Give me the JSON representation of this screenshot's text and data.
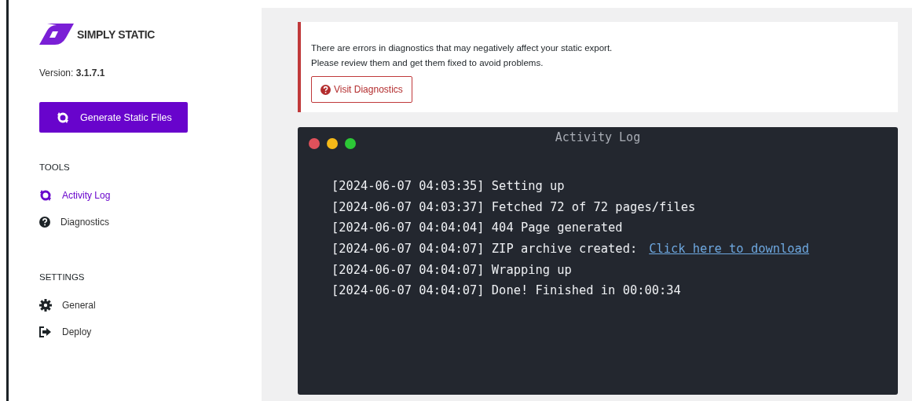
{
  "brand": {
    "name": "SIMPLY STATIC"
  },
  "version": "Version: **3.1.7.1**",
  "generate_button": {
    "label": "Generate Static Files"
  },
  "sections": [
    {
      "title": "TOOLS",
      "items": [
        {
          "label": "Activity Log",
          "kind": "sync",
          "selected": true
        },
        {
          "label": "Diagnostics",
          "kind": "question",
          "selected": false
        }
      ]
    },
    {
      "title": "SETTINGS",
      "items": [
        {
          "label": "General",
          "kind": "gear",
          "selected": false
        },
        {
          "label": "Deploy",
          "kind": "exit",
          "selected": false
        }
      ]
    }
  ],
  "notice": {
    "lines": [
      "There are errors in diagnostics that may negatively affect your static export.",
      "Please review them and get them fixed to avoid problems."
    ],
    "button": "Visit Diagnostics"
  },
  "log": {
    "title": "Activity Log",
    "entries": [
      {
        "time": "[2024-06-07 04:03:35]",
        "message": "Setting up"
      },
      {
        "time": "[2024-06-07 04:03:37]",
        "message": "Fetched 72 of 72 pages/files"
      },
      {
        "time": "[2024-06-07 04:04:04]",
        "message": "404 Page generated"
      },
      {
        "time": "[2024-06-07 04:04:07]",
        "message": "ZIP archive created:",
        "link": "Click here to download"
      },
      {
        "time": "[2024-06-07 04:04:07]",
        "message": "Wrapping up"
      },
      {
        "time": "[2024-06-07 04:04:07]",
        "message": "Done! Finished in 00:00:34"
      }
    ]
  }
}
